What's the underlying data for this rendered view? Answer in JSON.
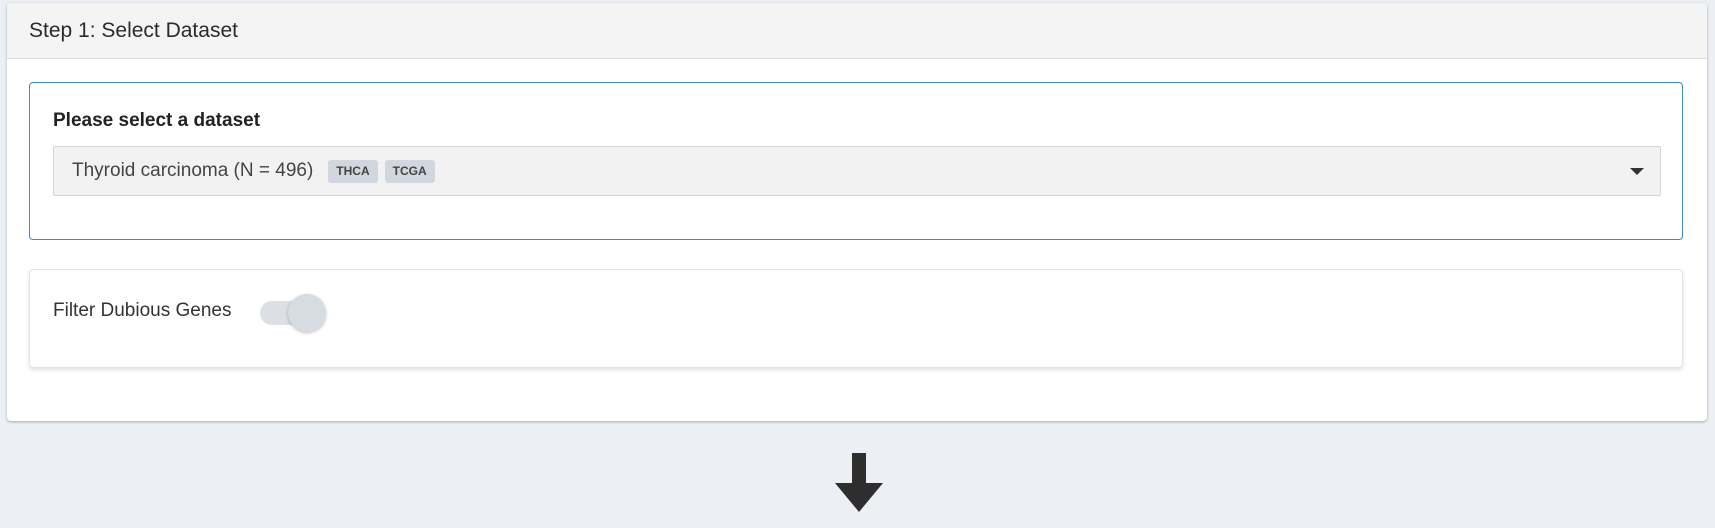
{
  "step": {
    "title": "Step 1: Select Dataset"
  },
  "dataset_select": {
    "label": "Please select a dataset",
    "selected_value": "Thyroid carcinoma (N = 496)",
    "tags": [
      "THCA",
      "TCGA"
    ]
  },
  "filter": {
    "label": "Filter Dubious Genes",
    "enabled": false
  },
  "icons": {
    "dropdown": "chevron-down-icon",
    "flow": "arrow-down-icon"
  },
  "colors": {
    "accent_border": "#3c8dbc",
    "page_background": "#eceff4",
    "badge_background": "#d2d6de"
  }
}
